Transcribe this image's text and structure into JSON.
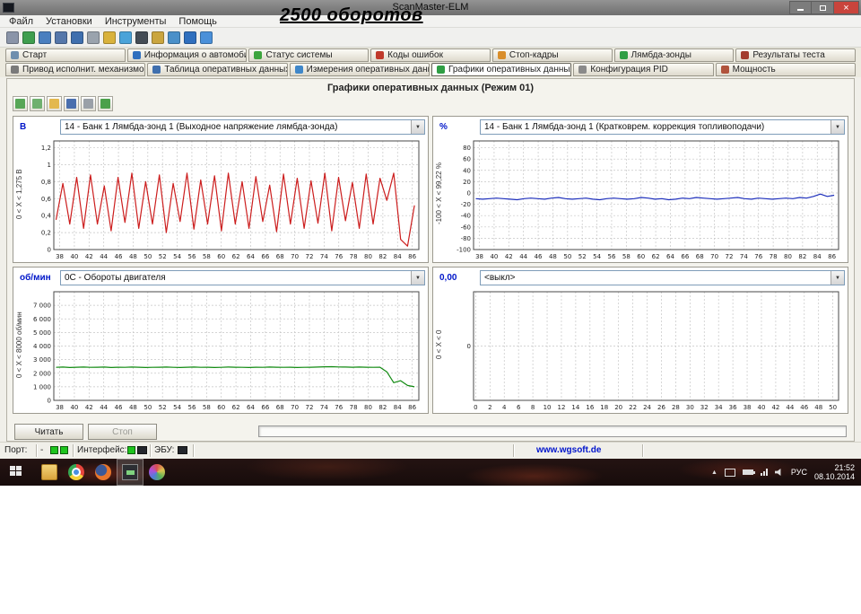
{
  "window": {
    "title": "ScanMaster-ELM",
    "annotation": "2500 оборотов"
  },
  "menu": {
    "items": [
      {
        "name": "menu-file",
        "label": "Файл"
      },
      {
        "name": "menu-settings",
        "label": "Установки"
      },
      {
        "name": "menu-tools",
        "label": "Инструменты"
      },
      {
        "name": "menu-help",
        "label": "Помощь"
      }
    ]
  },
  "toolbar": {
    "icons": [
      {
        "name": "wrench-icon",
        "color": "#8a94a8"
      },
      {
        "name": "globe-icon",
        "color": "#3f9e4f"
      },
      {
        "name": "car-info-icon",
        "color": "#4a7fbf"
      },
      {
        "name": "monitor-icon",
        "color": "#5577aa"
      },
      {
        "name": "table-icon",
        "color": "#3f6fae"
      },
      {
        "name": "chip-icon",
        "color": "#9aa3ad"
      },
      {
        "name": "notes-icon",
        "color": "#d9b23c"
      },
      {
        "name": "comment-icon",
        "color": "#4aa3d9"
      },
      {
        "name": "battery-icon",
        "color": "#444c55"
      },
      {
        "name": "pencil-icon",
        "color": "#caa53f"
      },
      {
        "name": "world-icon",
        "color": "#4a90c9"
      },
      {
        "name": "info-icon",
        "color": "#2f6fbe"
      },
      {
        "name": "download-icon",
        "color": "#4a90d9"
      }
    ]
  },
  "tabs_row1": [
    {
      "name": "tab-start",
      "label": "Старт",
      "icon": "start-icon",
      "color": "#6f8fae"
    },
    {
      "name": "tab-vehicle-info",
      "label": "Информация о автомобиле",
      "icon": "vehicle-info-icon",
      "color": "#2f6fbe"
    },
    {
      "name": "tab-system-status",
      "label": "Статус системы",
      "icon": "system-status-icon",
      "color": "#3da53d"
    },
    {
      "name": "tab-error-codes",
      "label": "Коды ошибок",
      "icon": "error-codes-icon",
      "color": "#c0392b"
    },
    {
      "name": "tab-freeze-frames",
      "label": "Стоп-кадры",
      "icon": "freeze-frames-icon",
      "color": "#d98e2b"
    },
    {
      "name": "tab-lambda-sensors",
      "label": "Лямбда-зонды",
      "icon": "lambda-icon",
      "color": "#2f9e44"
    },
    {
      "name": "tab-test-results",
      "label": "Результаты теста",
      "icon": "test-results-icon",
      "color": "#a33c2f"
    }
  ],
  "tabs_row2": [
    {
      "name": "tab-actuators",
      "label": "Привод исполнит. механизмов",
      "icon": "actuator-icon",
      "color": "#7a7a7a"
    },
    {
      "name": "tab-live-data-table",
      "label": "Таблица оперативных данных",
      "icon": "data-table-icon",
      "color": "#3f6fae"
    },
    {
      "name": "tab-live-data-measure",
      "label": "Измерения оперативных данных",
      "icon": "measurements-icon",
      "color": "#3f87c9"
    },
    {
      "name": "tab-live-data-graphs",
      "label": "Графики оперативных данных",
      "icon": "graphs-icon",
      "color": "#2f9e44",
      "active": true
    },
    {
      "name": "tab-pid-config",
      "label": "Конфигурация PID",
      "icon": "pid-config-icon",
      "color": "#8a8a8a"
    },
    {
      "name": "tab-power",
      "label": "Мощность",
      "icon": "power-icon",
      "color": "#b0533c"
    }
  ],
  "panel": {
    "title": "Графики оперативных данных (Режим 01)"
  },
  "chart_toolbar": [
    {
      "name": "chart-tile-icon",
      "color": "#57a657"
    },
    {
      "name": "chart-layout-icon",
      "color": "#6fb06f"
    },
    {
      "name": "chart-open-icon",
      "color": "#e3b84e"
    },
    {
      "name": "chart-save-icon",
      "color": "#4a6fae"
    },
    {
      "name": "chart-print-icon",
      "color": "#9aa0a8"
    },
    {
      "name": "chart-export-icon",
      "color": "#4ba04b"
    }
  ],
  "controls": {
    "read_button": "Читать",
    "stop_button": "Стоп"
  },
  "statusbar": {
    "port_label": "Порт:",
    "port_value": "-",
    "interface_label": "Интерфейс:",
    "ecu_label": "ЭБУ:",
    "website": "www.wgsoft.de"
  },
  "taskbar": {
    "lang": "РУС",
    "time": "21:52",
    "date": "08.10.2014",
    "apps": [
      {
        "name": "explorer"
      },
      {
        "name": "chrome"
      },
      {
        "name": "firefox"
      },
      {
        "name": "scanmaster",
        "active": true
      },
      {
        "name": "paint"
      }
    ]
  },
  "chart_data": [
    {
      "type": "line",
      "unit": "В",
      "selector": "14 - Банк 1 Лямбда-зонд 1 (Выходное напряжение лямбда-зонда)",
      "range_label": "0 < X < 1,275 В",
      "color": "#cc1d1d",
      "ylim": [
        0,
        1.28
      ],
      "yticks": [
        {
          "v": 1.2,
          "label": "1,2"
        },
        {
          "v": 1.0,
          "label": "1"
        },
        {
          "v": 0.8,
          "label": "0,8"
        },
        {
          "v": 0.6,
          "label": "0,6"
        },
        {
          "v": 0.4,
          "label": "0,4"
        },
        {
          "v": 0.2,
          "label": "0,2"
        },
        {
          "v": 0,
          "label": "0"
        }
      ],
      "xlim": [
        37.2,
        86.9
      ],
      "xticks": [
        38,
        40,
        42,
        44,
        46,
        48,
        50,
        52,
        54,
        56,
        58,
        60,
        62,
        64,
        66,
        68,
        70,
        72,
        74,
        76,
        78,
        80,
        82,
        84,
        86
      ],
      "xspan": [
        37.5,
        86.3
      ],
      "values": [
        0.35,
        0.78,
        0.3,
        0.85,
        0.25,
        0.88,
        0.3,
        0.75,
        0.22,
        0.85,
        0.32,
        0.9,
        0.25,
        0.8,
        0.3,
        0.88,
        0.2,
        0.78,
        0.33,
        0.9,
        0.24,
        0.82,
        0.3,
        0.87,
        0.22,
        0.9,
        0.3,
        0.8,
        0.25,
        0.86,
        0.33,
        0.76,
        0.21,
        0.89,
        0.3,
        0.84,
        0.25,
        0.81,
        0.31,
        0.9,
        0.22,
        0.85,
        0.34,
        0.79,
        0.25,
        0.89,
        0.3,
        0.84,
        0.58,
        0.9,
        0.12,
        0.04,
        0.52
      ]
    },
    {
      "type": "line",
      "unit": "%",
      "selector": "14 - Банк 1 Лямбда-зонд 1 (Кратковрем. коррекция топливоподачи)",
      "range_label": "-100 < X < 99,22 %",
      "color": "#1d2fbb",
      "ylim": [
        -100,
        92
      ],
      "yticks": [
        {
          "v": 80,
          "label": "80"
        },
        {
          "v": 60,
          "label": "60"
        },
        {
          "v": 40,
          "label": "40"
        },
        {
          "v": 20,
          "label": "20"
        },
        {
          "v": 0,
          "label": "0"
        },
        {
          "v": -20,
          "label": "-20"
        },
        {
          "v": -40,
          "label": "-40"
        },
        {
          "v": -60,
          "label": "-60"
        },
        {
          "v": -80,
          "label": "-80"
        },
        {
          "v": -100,
          "label": "-100"
        }
      ],
      "xlim": [
        37.2,
        86.9
      ],
      "xticks": [
        38,
        40,
        42,
        44,
        46,
        48,
        50,
        52,
        54,
        56,
        58,
        60,
        62,
        64,
        66,
        68,
        70,
        72,
        74,
        76,
        78,
        80,
        82,
        84,
        86
      ],
      "xspan": [
        37.5,
        86.3
      ],
      "values": [
        -10,
        -11,
        -10,
        -9,
        -10,
        -11,
        -12,
        -10,
        -9,
        -10,
        -11,
        -9,
        -8,
        -10,
        -11,
        -10,
        -9,
        -11,
        -12,
        -10,
        -9,
        -10,
        -11,
        -10,
        -8,
        -9,
        -11,
        -10,
        -12,
        -11,
        -9,
        -10,
        -8,
        -9,
        -10,
        -11,
        -10,
        -9,
        -8,
        -10,
        -11,
        -9,
        -10,
        -11,
        -10,
        -9,
        -10,
        -8,
        -9,
        -6,
        -2,
        -6,
        -4
      ]
    },
    {
      "type": "line",
      "unit": "об/мин",
      "selector": "0C - Обороты двигателя",
      "range_label": "0 < X < 8000 об/мин",
      "color": "#118a11",
      "ylim": [
        0,
        8000
      ],
      "yticks": [
        {
          "v": 7000,
          "label": "7 000"
        },
        {
          "v": 6000,
          "label": "6 000"
        },
        {
          "v": 5000,
          "label": "5 000"
        },
        {
          "v": 4000,
          "label": "4 000"
        },
        {
          "v": 3000,
          "label": "3 000"
        },
        {
          "v": 2000,
          "label": "2 000"
        },
        {
          "v": 1000,
          "label": "1 000"
        },
        {
          "v": 0,
          "label": "0"
        }
      ],
      "xlim": [
        37.2,
        86.9
      ],
      "xticks": [
        38,
        40,
        42,
        44,
        46,
        48,
        50,
        52,
        54,
        56,
        58,
        60,
        62,
        64,
        66,
        68,
        70,
        72,
        74,
        76,
        78,
        80,
        82,
        84,
        86
      ],
      "xspan": [
        37.5,
        86.3
      ],
      "values": [
        2430,
        2450,
        2420,
        2440,
        2450,
        2430,
        2440,
        2450,
        2420,
        2440,
        2430,
        2450,
        2440,
        2420,
        2430,
        2440,
        2450,
        2430,
        2420,
        2440,
        2450,
        2430,
        2440,
        2420,
        2430,
        2450,
        2440,
        2430,
        2420,
        2440,
        2430,
        2450,
        2440,
        2430,
        2440,
        2420,
        2430,
        2440,
        2450,
        2470,
        2480,
        2460,
        2450,
        2440,
        2450,
        2440,
        2430,
        2440,
        2100,
        1300,
        1450,
        1100,
        1000
      ]
    },
    {
      "type": "line",
      "unit": "0,00",
      "selector": "<выкл>",
      "range_label": "0 < X < 0",
      "color": "#888888",
      "ylim": [
        -1,
        1
      ],
      "yticks": [
        {
          "v": 0,
          "label": "0"
        }
      ],
      "xlim": [
        -0.3,
        50.8
      ],
      "xticks": [
        0,
        2,
        4,
        6,
        8,
        10,
        12,
        14,
        16,
        18,
        20,
        22,
        24,
        26,
        28,
        30,
        32,
        34,
        36,
        38,
        40,
        42,
        44,
        46,
        48,
        50
      ],
      "xspan": [
        0,
        50
      ],
      "values": []
    }
  ]
}
